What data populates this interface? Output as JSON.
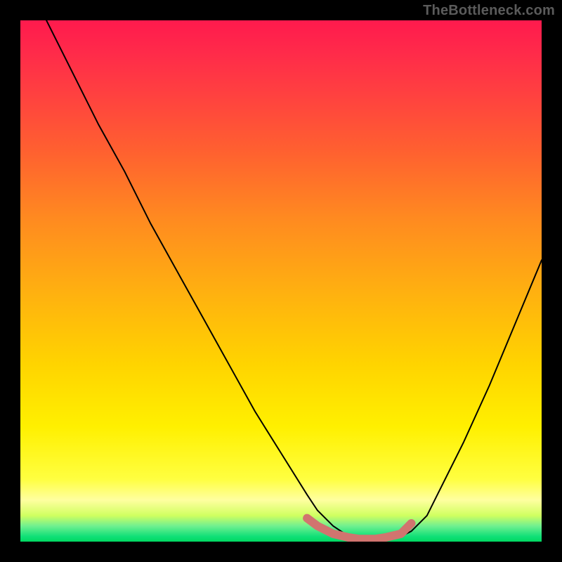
{
  "watermark": "TheBottleneck.com",
  "colors": {
    "frame": "#000000",
    "curve_stroke": "#000000",
    "accent_stroke": "#d1746f",
    "gradient_top": "#ff1a4d",
    "gradient_bottom": "#00d860"
  },
  "chart_data": {
    "type": "line",
    "title": "",
    "xlabel": "",
    "ylabel": "",
    "xlim": [
      0,
      100
    ],
    "ylim": [
      0,
      100
    ],
    "series": [
      {
        "name": "bottleneck-curve",
        "x": [
          5,
          10,
          15,
          20,
          25,
          30,
          35,
          40,
          45,
          50,
          55,
          57,
          60,
          63,
          65,
          68,
          70,
          73,
          75,
          78,
          80,
          85,
          90,
          95,
          100
        ],
        "y": [
          100,
          90,
          80,
          71,
          61,
          52,
          43,
          34,
          25,
          17,
          9,
          6,
          3,
          1,
          0.5,
          0.3,
          0.4,
          1,
          2,
          5,
          9,
          19,
          30,
          42,
          54
        ]
      }
    ],
    "accent_segment": {
      "name": "optimal-range-marker",
      "x": [
        55,
        57,
        60,
        63,
        65,
        68,
        70,
        73,
        75
      ],
      "y": [
        4.5,
        3,
        1.5,
        0.8,
        0.5,
        0.5,
        0.8,
        1.5,
        3.5
      ]
    }
  }
}
